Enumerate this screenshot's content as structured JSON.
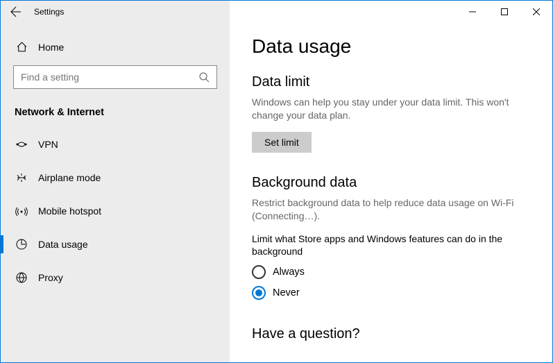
{
  "titlebar": {
    "title": "Settings"
  },
  "sidebar": {
    "home_label": "Home",
    "search_placeholder": "Find a setting",
    "category": "Network & Internet",
    "items": [
      {
        "label": "VPN"
      },
      {
        "label": "Airplane mode"
      },
      {
        "label": "Mobile hotspot"
      },
      {
        "label": "Data usage"
      },
      {
        "label": "Proxy"
      }
    ]
  },
  "main": {
    "heading": "Data usage",
    "data_limit": {
      "heading": "Data limit",
      "desc": "Windows can help you stay under your data limit. This won't change your data plan.",
      "button": "Set limit"
    },
    "background_data": {
      "heading": "Background data",
      "desc": "Restrict background data to help reduce data usage on Wi-Fi (Connecting…).",
      "option_label": "Limit what Store apps and Windows features can do in the background",
      "options": {
        "always": "Always",
        "never": "Never"
      }
    },
    "question": {
      "heading": "Have a question?"
    }
  }
}
